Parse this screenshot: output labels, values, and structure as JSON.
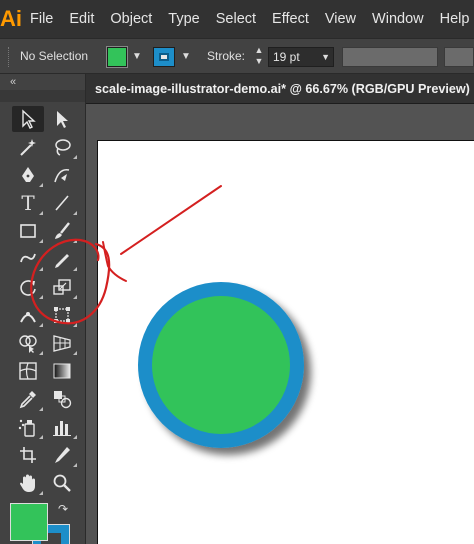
{
  "app": {
    "logo": "Ai"
  },
  "menu": [
    "File",
    "Edit",
    "Object",
    "Type",
    "Select",
    "Effect",
    "View",
    "Window",
    "Help"
  ],
  "control_bar": {
    "selection": "No Selection",
    "stroke_label": "Stroke:",
    "stroke_value": "19 pt"
  },
  "document": {
    "tab_title": "scale-image-illustrator-demo.ai* @ 66.67% (RGB/GPU Preview)"
  },
  "colors": {
    "fill": "#33c35a",
    "stroke": "#1d8ec9",
    "annotation": "#d42020",
    "logo": "#ff9a00"
  },
  "tools": [
    "selection-tool-icon",
    "direct-selection-tool-icon",
    "magic-wand-tool-icon",
    "lasso-tool-icon",
    "pen-tool-icon",
    "curvature-tool-icon",
    "type-tool-icon",
    "line-segment-tool-icon",
    "rectangle-tool-icon",
    "paintbrush-tool-icon",
    "shaper-tool-icon",
    "pencil-tool-icon",
    "rotate-tool-icon",
    "scale-tool-icon",
    "width-tool-icon",
    "free-transform-tool-icon",
    "shape-builder-tool-icon",
    "perspective-grid-tool-icon",
    "mesh-tool-icon",
    "gradient-tool-icon",
    "eyedropper-tool-icon",
    "blend-tool-icon",
    "symbol-sprayer-tool-icon",
    "column-graph-tool-icon",
    "artboard-tool-icon",
    "slice-tool-icon",
    "hand-tool-icon",
    "zoom-tool-icon"
  ]
}
